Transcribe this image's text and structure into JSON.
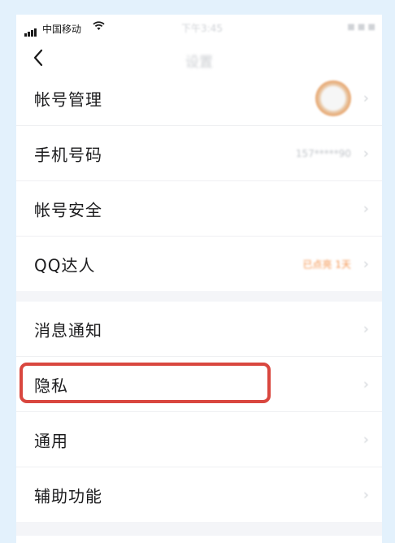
{
  "status_bar": {
    "carrier": "中国移动",
    "time": "下午3:45",
    "battery": "■ ■ ■"
  },
  "nav": {
    "title": "设置",
    "back_icon": "chevron-left-icon"
  },
  "groups": [
    {
      "items": [
        {
          "label": "帐号管理",
          "accessory": "avatar"
        },
        {
          "label": "手机号码",
          "value": "157*****90"
        },
        {
          "label": "帐号安全"
        },
        {
          "label": "QQ达人",
          "value": "已点亮 1天",
          "value_color": "#f4924c"
        }
      ]
    },
    {
      "items": [
        {
          "label": "消息通知"
        },
        {
          "label": "隐私",
          "highlighted": true
        },
        {
          "label": "通用"
        },
        {
          "label": "辅助功能"
        }
      ]
    }
  ],
  "colors": {
    "highlight_border": "#d9473f",
    "background": "#e3f1fc",
    "group_separator": "#f4f5f8"
  },
  "chevron_glyph": "›"
}
